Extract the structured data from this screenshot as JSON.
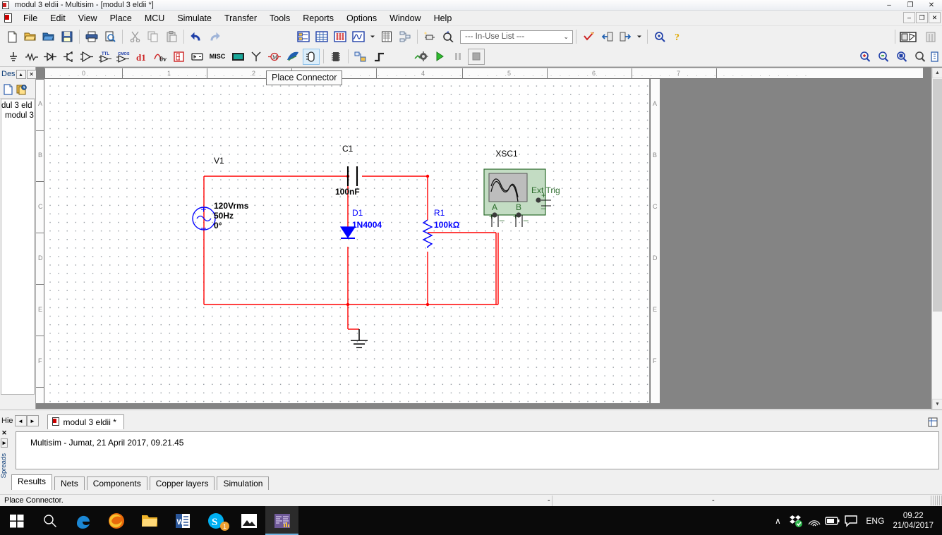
{
  "window": {
    "title": "modul 3 eldii - Multisim - [modul 3 eldii *]",
    "minimize": "–",
    "maximize": "❐",
    "close": "✕",
    "child_minimize": "–",
    "child_restore": "❐",
    "child_close": "✕"
  },
  "menu": {
    "items": [
      {
        "label": "File"
      },
      {
        "label": "Edit"
      },
      {
        "label": "View"
      },
      {
        "label": "Place"
      },
      {
        "label": "MCU"
      },
      {
        "label": "Simulate"
      },
      {
        "label": "Transfer"
      },
      {
        "label": "Tools"
      },
      {
        "label": "Reports"
      },
      {
        "label": "Options"
      },
      {
        "label": "Window"
      },
      {
        "label": "Help"
      }
    ]
  },
  "toolbar_standard": {
    "buttons": [
      {
        "name": "new-icon",
        "tip": "New"
      },
      {
        "name": "open-icon",
        "tip": "Open"
      },
      {
        "name": "open-design-icon",
        "tip": "Open design"
      },
      {
        "name": "save-icon",
        "tip": "Save"
      },
      {
        "name": "print-icon",
        "tip": "Print"
      },
      {
        "name": "print-preview-icon",
        "tip": "Print preview"
      },
      {
        "name": "cut-icon",
        "tip": "Cut"
      },
      {
        "name": "copy-icon",
        "tip": "Copy"
      },
      {
        "name": "paste-icon",
        "tip": "Paste"
      },
      {
        "name": "undo-icon",
        "tip": "Undo"
      },
      {
        "name": "redo-icon",
        "tip": "Redo"
      }
    ]
  },
  "toolbar_view": {
    "buttons": [
      {
        "name": "design-toolbox-icon",
        "tip": "Toggle design toolbox"
      },
      {
        "name": "spreadsheet-view-icon",
        "tip": "Toggle spreadsheet view"
      },
      {
        "name": "database-icon",
        "tip": "Database manager"
      },
      {
        "name": "grapher-icon",
        "tip": "Grapher/analyses"
      },
      {
        "name": "chevron-down-icon",
        "tip": "More"
      },
      {
        "name": "postprocessor-icon",
        "tip": "Postprocessor"
      },
      {
        "name": "hierarchy-icon",
        "tip": "Hierarchy"
      },
      {
        "name": "new-component-icon",
        "tip": "Create component"
      },
      {
        "name": "edit-component-icon",
        "tip": "Edit component"
      }
    ],
    "in_use_list": "--- In-Use List ---",
    "in_use_arrow": "⌄",
    "buttons_right": [
      {
        "name": "erc-check-icon",
        "tip": "Electrical rules check"
      },
      {
        "name": "back-annotate-icon",
        "tip": "Back annotate from Ultiboard"
      },
      {
        "name": "forward-annotate-icon",
        "tip": "Forward annotate to Ultiboard"
      },
      {
        "name": "annotate-chevron-icon",
        "tip": "More"
      },
      {
        "name": "find-icon",
        "tip": "Find"
      },
      {
        "name": "help-icon",
        "tip": "Help"
      }
    ],
    "capture_icon": "capture-screen-area-icon"
  },
  "toolbar_components": {
    "buttons": [
      {
        "name": "place-source-icon",
        "tip": "Place source"
      },
      {
        "name": "place-basic-icon",
        "tip": "Place basic"
      },
      {
        "name": "place-diode-icon",
        "tip": "Place diode"
      },
      {
        "name": "place-transistor-icon",
        "tip": "Place transistor"
      },
      {
        "name": "place-analog-icon",
        "tip": "Place analog"
      },
      {
        "name": "place-ttl-icon",
        "tip": "Place TTL"
      },
      {
        "name": "place-cmos-icon",
        "tip": "Place CMOS"
      },
      {
        "name": "place-misc-digital-icon",
        "tip": "Place misc digital"
      },
      {
        "name": "place-mixed-icon",
        "tip": "Place mixed"
      },
      {
        "name": "place-indicator-icon",
        "tip": "Place indicator"
      },
      {
        "name": "place-power-icon",
        "tip": "Place power component"
      },
      {
        "name": "place-misc-icon",
        "tip": "Place misc",
        "label": "MISC"
      },
      {
        "name": "place-advanced-peripherals-icon",
        "tip": "Place advanced peripherals"
      },
      {
        "name": "place-rf-icon",
        "tip": "Place RF"
      },
      {
        "name": "place-electromechanical-icon",
        "tip": "Place electromechanical"
      },
      {
        "name": "place-ni-components-icon",
        "tip": "Place NI components"
      },
      {
        "name": "place-connector-icon",
        "tip": "Place connector"
      },
      {
        "name": "place-mcu-icon",
        "tip": "Place MCU"
      },
      {
        "name": "place-hierarchical-block-icon",
        "tip": "Place hierarchical block"
      },
      {
        "name": "place-bus-icon",
        "tip": "Place bus"
      }
    ]
  },
  "toolbar_simulate": {
    "buttons": [
      {
        "name": "interactive-simulation-icon",
        "tip": "Interactive simulation settings"
      },
      {
        "name": "run-icon",
        "tip": "Run"
      },
      {
        "name": "pause-icon",
        "tip": "Pause"
      },
      {
        "name": "stop-icon",
        "tip": "Stop"
      }
    ]
  },
  "toolbar_zoom": {
    "buttons": [
      {
        "name": "zoom-in-icon",
        "tip": "Zoom in"
      },
      {
        "name": "zoom-out-icon",
        "tip": "Zoom out"
      },
      {
        "name": "zoom-area-icon",
        "tip": "Zoom area"
      },
      {
        "name": "zoom-fit-icon",
        "tip": "Zoom to fit"
      },
      {
        "name": "zoom-selection-icon",
        "tip": "Zoom selection"
      }
    ]
  },
  "tooltip": {
    "text": "Place Connector"
  },
  "design_toolbox": {
    "title": "Des",
    "collapse": "▴",
    "close": "✕",
    "tool_icons": [
      {
        "name": "new-sheet-icon"
      },
      {
        "name": "visibility-icon"
      }
    ],
    "tree": [
      {
        "label": "dul 3 eld"
      },
      {
        "label": "modul 3"
      }
    ]
  },
  "ruler": {
    "horizontal": [
      "0",
      "1",
      "2",
      "3",
      "4",
      "5",
      "6",
      "7"
    ],
    "vertical": [
      "A",
      "B",
      "C",
      "D",
      "E",
      "F"
    ]
  },
  "circuit": {
    "components": [
      {
        "ref": "V1",
        "name": "ac-voltage-source",
        "value_lines": [
          "120Vrms",
          "50Hz",
          "0°"
        ]
      },
      {
        "ref": "C1",
        "name": "capacitor",
        "value": "100nF"
      },
      {
        "ref": "D1",
        "name": "diode",
        "value": "1N4004"
      },
      {
        "ref": "R1",
        "name": "resistor",
        "value": "100kΩ"
      },
      {
        "ref": "XSC1",
        "name": "oscilloscope",
        "terminals": [
          "A",
          "B"
        ],
        "ext_trig": "Ext Trig"
      },
      {
        "ref": "",
        "name": "ground",
        "value": ""
      }
    ],
    "wire_color": "#ff0000",
    "component_color": "#0000ff",
    "label_color": "#000000"
  },
  "document_tabs": {
    "hierarchy_label": "Hie",
    "prev": "◄",
    "next": "►",
    "tabs": [
      {
        "label": "modul 3 eldii *",
        "active": true
      }
    ]
  },
  "spreadsheet": {
    "close": "✕",
    "expand": "▸",
    "panel_title": "Spreads",
    "results_line": "Multisim  -  Jumat, 21 April 2017, 09.21.45",
    "tabs": [
      {
        "label": "Results",
        "active": true
      },
      {
        "label": "Nets",
        "active": false
      },
      {
        "label": "Components",
        "active": false
      },
      {
        "label": "Copper layers",
        "active": false
      },
      {
        "label": "Simulation",
        "active": false
      }
    ]
  },
  "status_bar": {
    "message": "Place Connector.",
    "cell2": "-",
    "cell3": "",
    "cell4": "-"
  },
  "taskbar": {
    "items": [
      {
        "name": "start-button",
        "label": "Start"
      },
      {
        "name": "search-icon",
        "label": "Search"
      },
      {
        "name": "edge-icon",
        "label": "Microsoft Edge"
      },
      {
        "name": "firefox-icon",
        "label": "Mozilla Firefox"
      },
      {
        "name": "file-explorer-icon",
        "label": "File Explorer"
      },
      {
        "name": "word-icon",
        "label": "Microsoft Word"
      },
      {
        "name": "skype-icon",
        "label": "Skype",
        "badge": "1"
      },
      {
        "name": "photos-icon",
        "label": "Photos"
      },
      {
        "name": "multisim-icon",
        "label": "Multisim",
        "active": true
      }
    ],
    "tray": {
      "chevron": "∧",
      "icons": [
        {
          "name": "dropbox-icon"
        },
        {
          "name": "wifi-icon"
        },
        {
          "name": "battery-icon"
        },
        {
          "name": "action-center-icon"
        }
      ],
      "language": "ENG",
      "time": "09.22",
      "date": "21/04/2017"
    }
  }
}
